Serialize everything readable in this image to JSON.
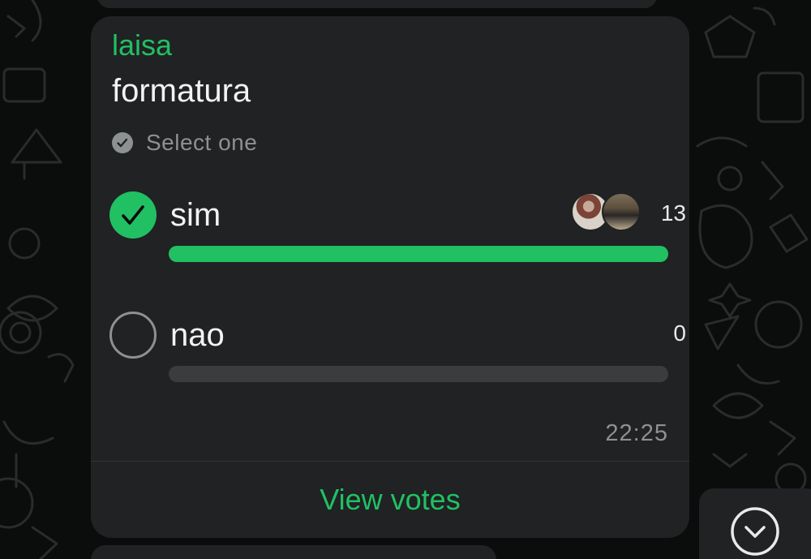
{
  "poll": {
    "sender": "laisa",
    "question": "formatura",
    "hint": "Select one",
    "options": [
      {
        "label": "sim",
        "count": "13",
        "selected": true,
        "fraction": 1.0
      },
      {
        "label": "nao",
        "count": "0",
        "selected": false,
        "fraction": 0.0
      }
    ],
    "time": "22:25",
    "view_votes_label": "View votes"
  },
  "colors": {
    "accent": "#21c063",
    "bubble": "#202223",
    "background": "#0b0c0c"
  },
  "icons": {
    "hint": "check-circle-icon",
    "selected": "check-icon",
    "scroll": "chevron-down-icon"
  }
}
